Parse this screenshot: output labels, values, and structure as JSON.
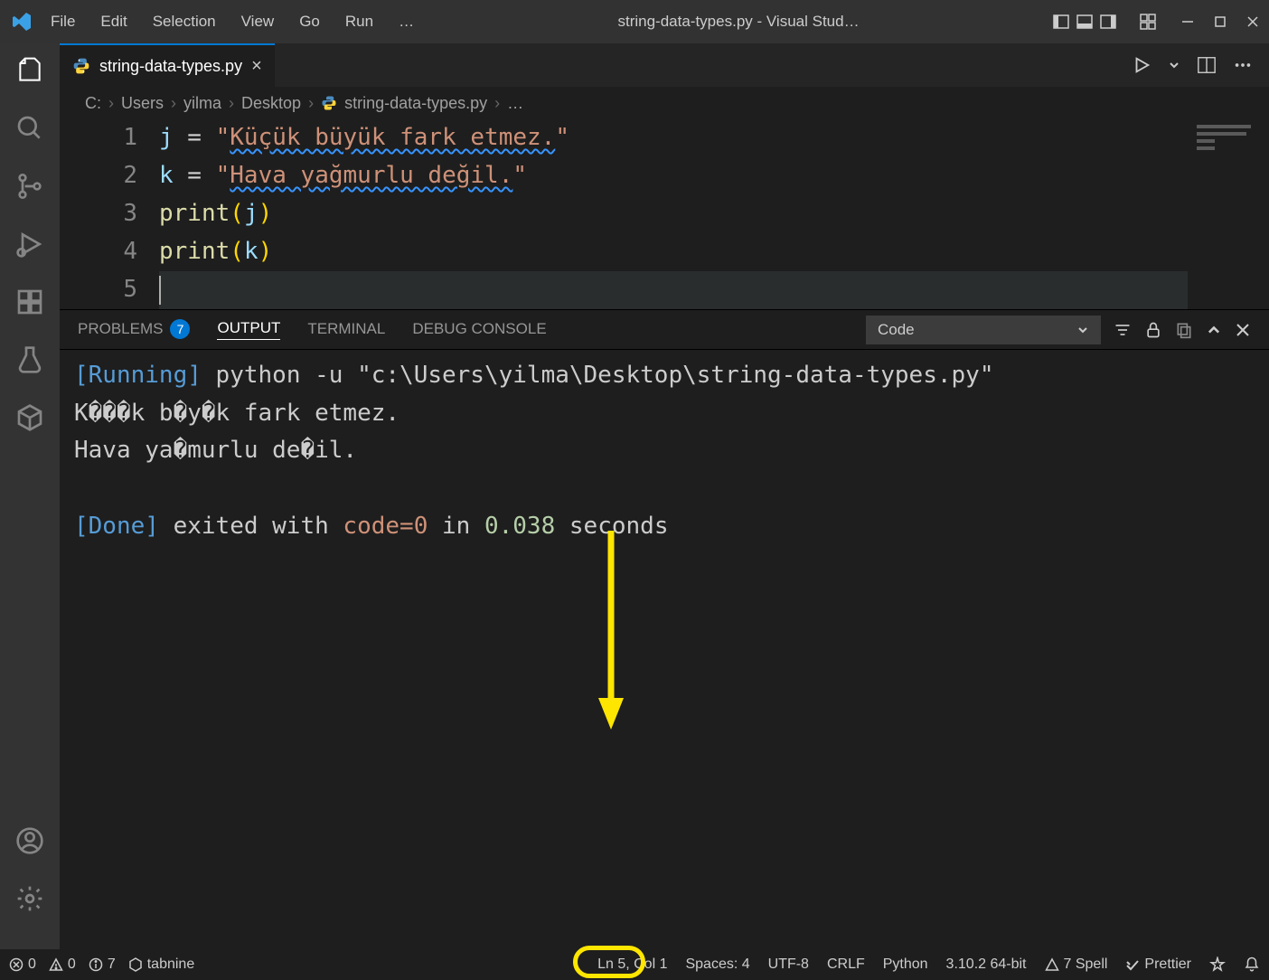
{
  "title": "string-data-types.py - Visual Stud…",
  "menu": [
    "File",
    "Edit",
    "Selection",
    "View",
    "Go",
    "Run",
    "…"
  ],
  "tab": {
    "filename": "string-data-types.py"
  },
  "breadcrumbs": [
    "C:",
    "Users",
    "yilma",
    "Desktop",
    "string-data-types.py",
    "…"
  ],
  "code": {
    "lines": [
      {
        "n": 1,
        "var": "j",
        "str_open": "\"",
        "str_body": "Küçük büyük fark etmez.",
        "str_close": "\""
      },
      {
        "n": 2,
        "var": "k",
        "str_open": "\"",
        "str_body": "Hava yağmurlu değil.",
        "str_close": "\""
      },
      {
        "n": 3,
        "fn": "print",
        "arg": "j"
      },
      {
        "n": 4,
        "fn": "print",
        "arg": "k"
      },
      {
        "n": 5
      }
    ]
  },
  "panel": {
    "tabs": {
      "problems": "PROBLEMS",
      "problems_count": "7",
      "output": "OUTPUT",
      "terminal": "TERMINAL",
      "debug": "DEBUG CONSOLE"
    },
    "selector": "Code",
    "output": {
      "running_tag": "[Running]",
      "running_cmd": "python -u \"c:\\Users\\yilma\\Desktop\\string-data-types.py\"",
      "line1": "K���k b�y�k fark etmez.",
      "line2": "Hava ya�murlu de�il.",
      "done_tag": "[Done]",
      "done_mid1": " exited with ",
      "done_code": "code=0",
      "done_mid2": " in ",
      "done_time": "0.038",
      "done_tail": " seconds"
    }
  },
  "status": {
    "errors": "0",
    "warnings": "0",
    "info": "7",
    "tabnine": "tabnine",
    "lncol": "Ln 5, Col 1",
    "spaces": "Spaces: 4",
    "encoding": "UTF-8",
    "eol": "CRLF",
    "lang": "Python",
    "interpreter": "3.10.2 64-bit",
    "spell": "7 Spell",
    "prettier": "Prettier"
  }
}
